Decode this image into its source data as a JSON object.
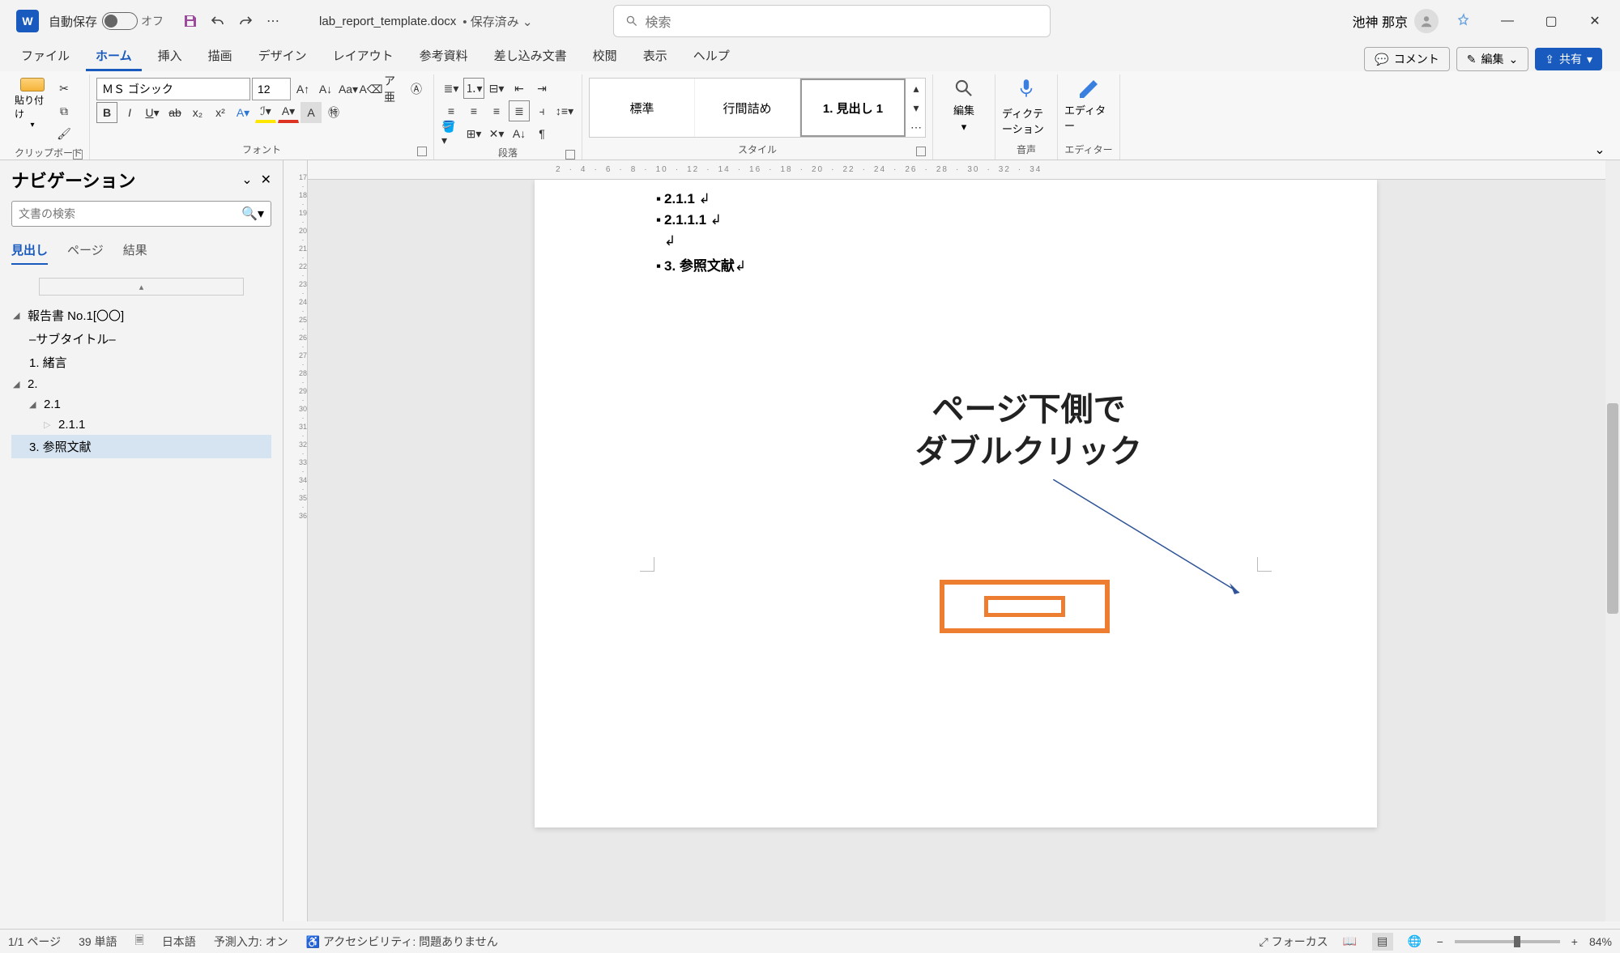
{
  "titlebar": {
    "autosave_label": "自動保存",
    "autosave_state": "オフ",
    "filename": "lab_report_template.docx",
    "saved_state": "• 保存済み",
    "search_placeholder": "検索",
    "user_name": "池神 那京"
  },
  "tabs": {
    "items": [
      "ファイル",
      "ホーム",
      "挿入",
      "描画",
      "デザイン",
      "レイアウト",
      "参考資料",
      "差し込み文書",
      "校閲",
      "表示",
      "ヘルプ"
    ],
    "active_index": 1,
    "comment": "コメント",
    "editing": "編集",
    "share": "共有"
  },
  "ribbon": {
    "clipboard": {
      "paste": "貼り付け",
      "label": "クリップボード"
    },
    "font": {
      "name": "ＭＳ ゴシック",
      "size": "12",
      "label": "フォント"
    },
    "paragraph": {
      "label": "段落"
    },
    "styles": {
      "items": [
        "標準",
        "行間詰め",
        "1. 見出し 1"
      ],
      "selected_index": 2,
      "label": "スタイル"
    },
    "editing": {
      "label": "編集"
    },
    "dictation": {
      "label": "ディクテーション",
      "group": "音声"
    },
    "editor": {
      "label": "エディター",
      "group": "エディター"
    }
  },
  "nav": {
    "title": "ナビゲーション",
    "search_placeholder": "文書の検索",
    "tabs": [
      "見出し",
      "ページ",
      "結果"
    ],
    "active_tab": 0,
    "tree": {
      "n0": "報告書 No.1[〇〇]",
      "n1": "–サブタイトル–",
      "n2": "1. 緒言",
      "n3": "2.",
      "n4": "2.1",
      "n5": "2.1.1",
      "n6": "3. 参照文献"
    },
    "selected": "n6"
  },
  "document": {
    "lines": {
      "l0": "2.1.1",
      "l1": "2.1.1.1",
      "l2": "3. 参照文献"
    },
    "ruler_h": [
      "2",
      "4",
      "6",
      "8",
      "10",
      "12",
      "14",
      "16",
      "18",
      "20",
      "22",
      "24",
      "26",
      "28",
      "30",
      "32",
      "34"
    ],
    "ruler_v": [
      "17",
      "18",
      "19",
      "20",
      "21",
      "22",
      "23",
      "24",
      "25",
      "26",
      "27",
      "28",
      "29",
      "30",
      "31",
      "32",
      "33",
      "34",
      "35",
      "36"
    ]
  },
  "annotation": {
    "line1": "ページ下側で",
    "line2": "ダブルクリック"
  },
  "status": {
    "page": "1/1 ページ",
    "words": "39 単語",
    "language": "日本語",
    "predictive": "予測入力: オン",
    "accessibility": "アクセシビリティ: 問題ありません",
    "focus": "フォーカス",
    "zoom": "84%"
  }
}
